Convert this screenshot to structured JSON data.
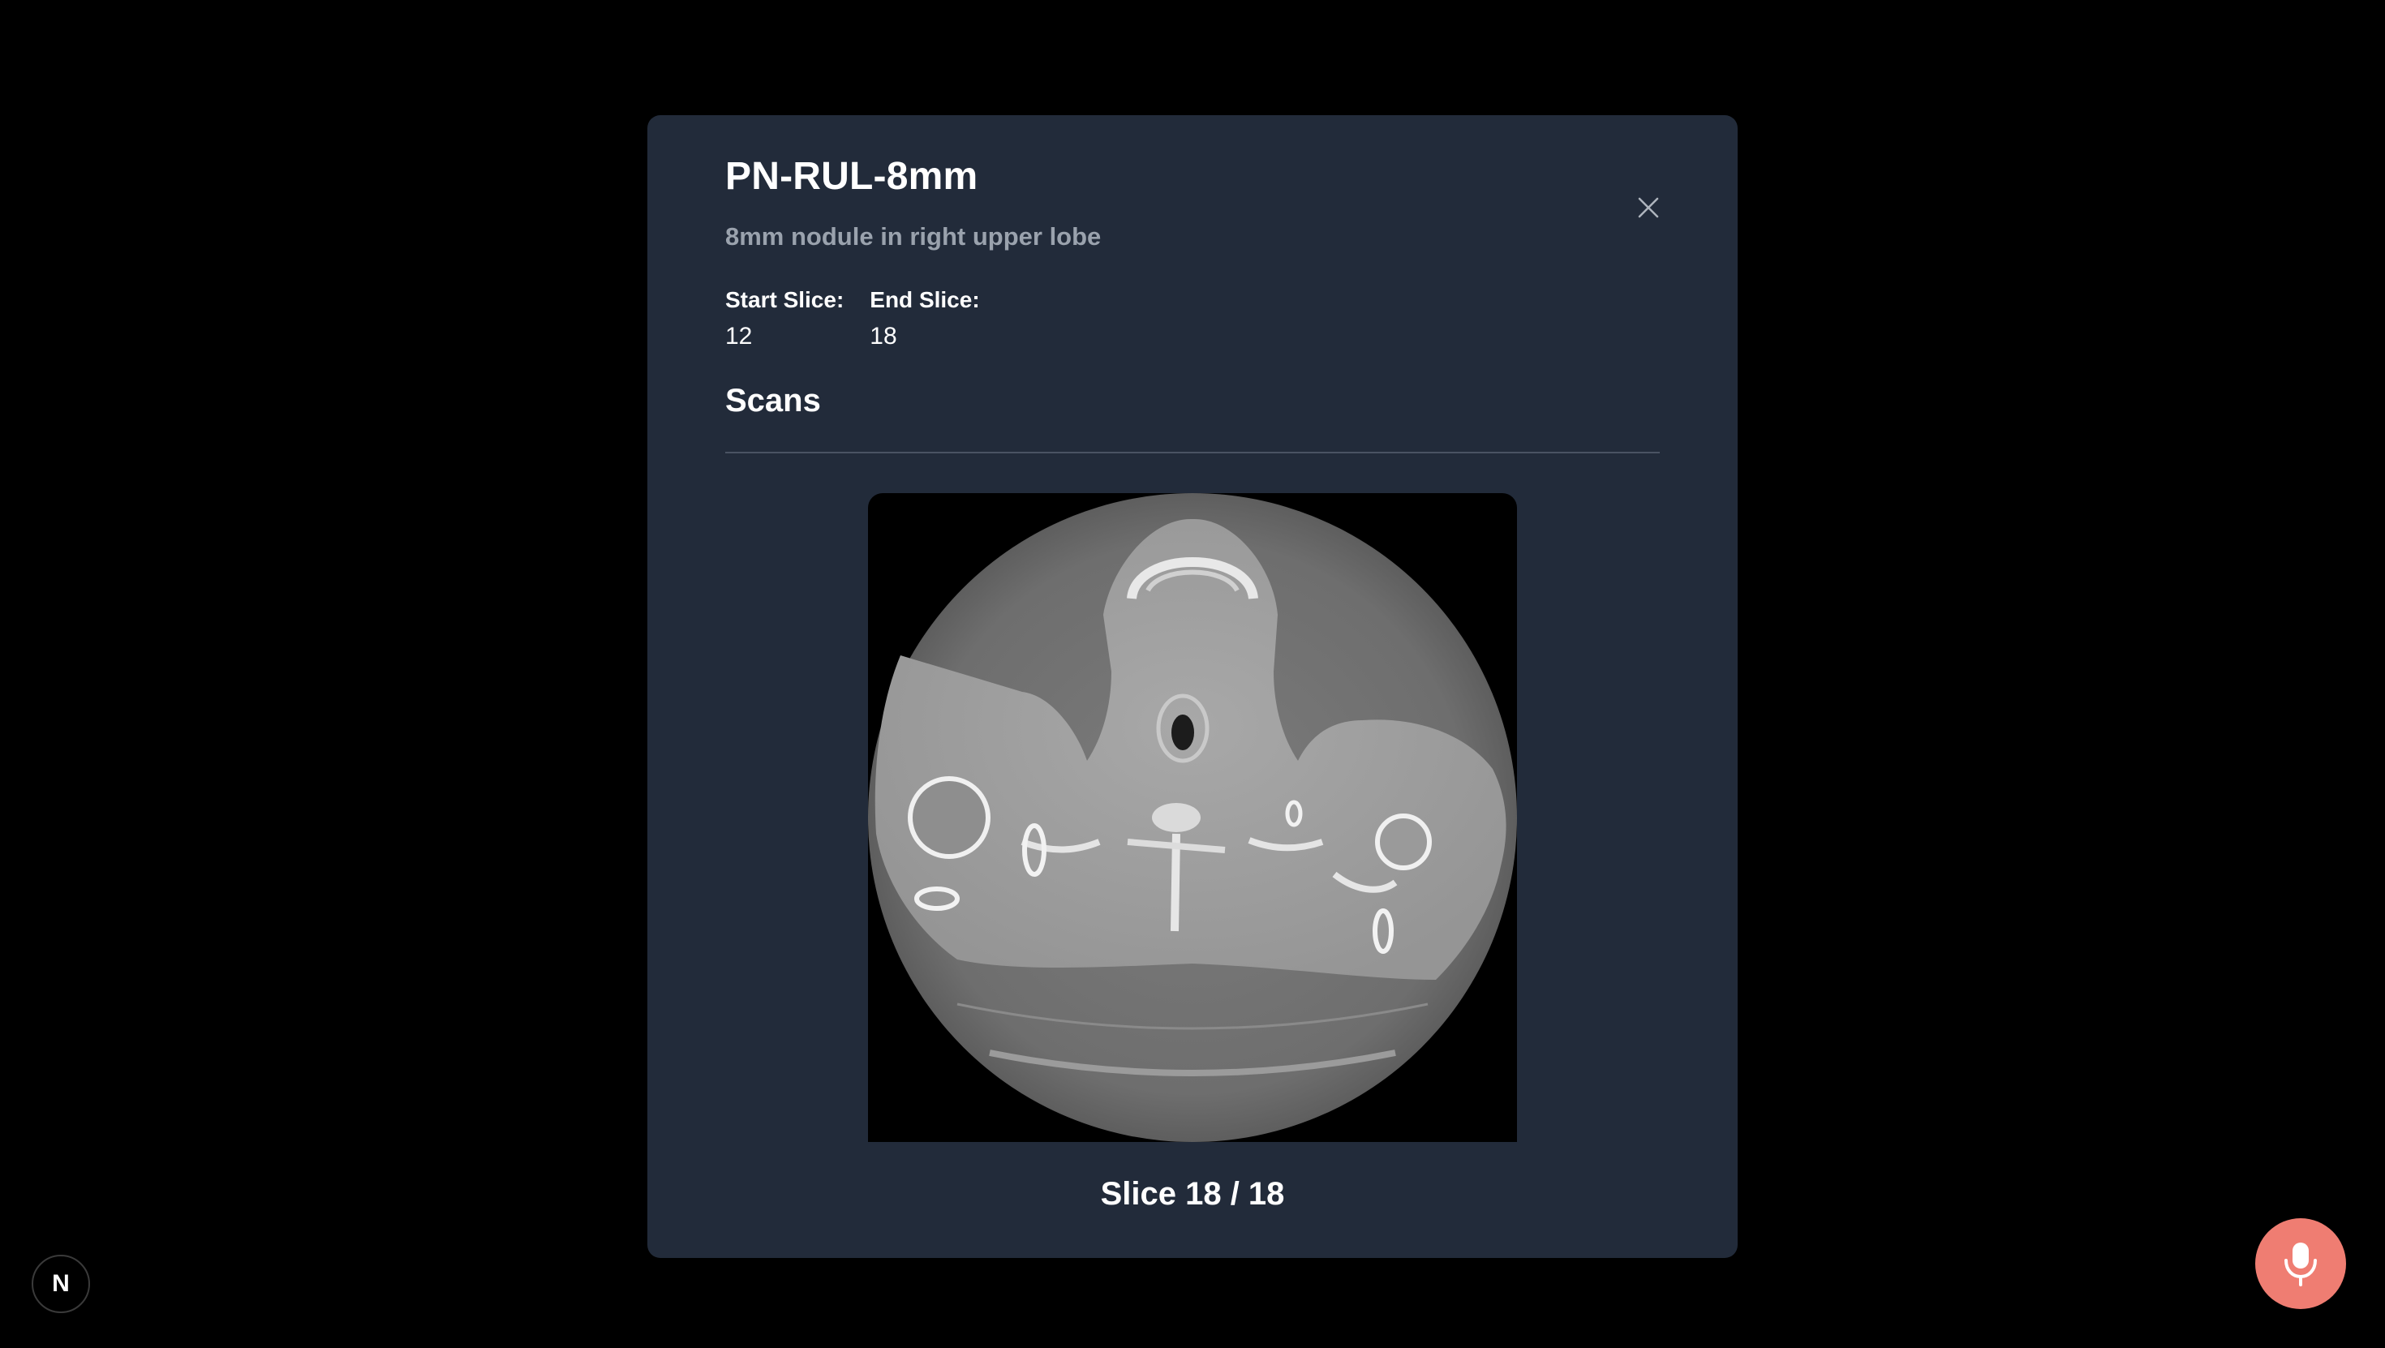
{
  "modal": {
    "title": "PN-RUL-8mm",
    "subtitle": "8mm nodule in right upper lobe",
    "start_slice_label": "Start Slice:",
    "start_slice_value": "12",
    "end_slice_label": "End Slice:",
    "end_slice_value": "18",
    "section_title": "Scans",
    "slice_caption": "Slice 18 / 18",
    "close_icon": "close-icon"
  },
  "scan": {
    "current_slice": 18,
    "total_slices": 18,
    "image_description_icon": "ct-scan-image"
  },
  "badge": {
    "letter": "N",
    "icon": "nextjs-logo-icon"
  },
  "mic": {
    "icon": "microphone-icon",
    "color": "#ef7d72"
  },
  "colors": {
    "modal_bg": "#222b3a",
    "page_bg": "#000000",
    "subtitle": "#9aa2ad"
  }
}
